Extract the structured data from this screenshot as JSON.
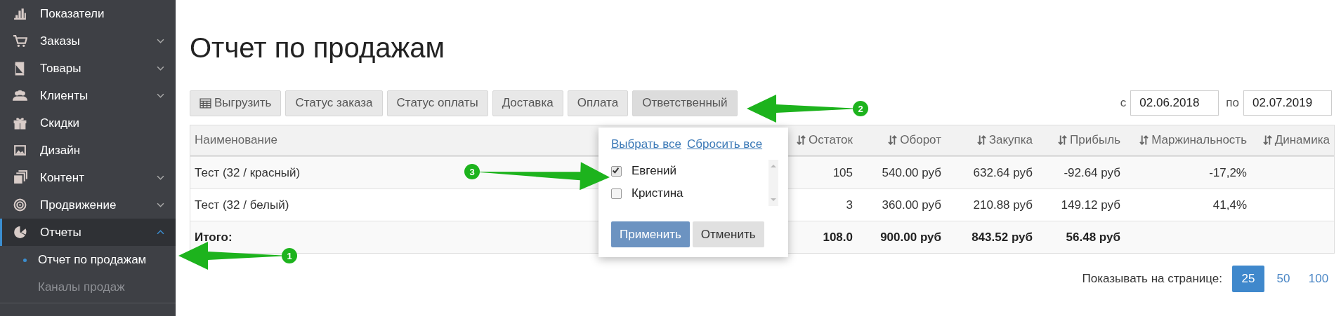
{
  "sidebar": {
    "items": [
      {
        "label": "Показатели",
        "expandable": false,
        "expanded": false,
        "selected": false
      },
      {
        "label": "Заказы",
        "expandable": true,
        "expanded": false,
        "selected": false
      },
      {
        "label": "Товары",
        "expandable": true,
        "expanded": false,
        "selected": false
      },
      {
        "label": "Клиенты",
        "expandable": true,
        "expanded": false,
        "selected": false
      },
      {
        "label": "Скидки",
        "expandable": false,
        "expanded": false,
        "selected": false
      },
      {
        "label": "Дизайн",
        "expandable": false,
        "expanded": false,
        "selected": false
      },
      {
        "label": "Контент",
        "expandable": true,
        "expanded": false,
        "selected": false
      },
      {
        "label": "Продвижение",
        "expandable": true,
        "expanded": false,
        "selected": false
      },
      {
        "label": "Отчеты",
        "expandable": true,
        "expanded": true,
        "selected": true,
        "children": [
          {
            "label": "Отчет по продажам",
            "selected": true
          },
          {
            "label": "Каналы продаж",
            "selected": false
          }
        ]
      }
    ]
  },
  "page": {
    "title": "Отчет по продажам"
  },
  "toolbar": {
    "buttons": [
      {
        "label": "Выгрузить",
        "kind": "export",
        "expanded": false
      },
      {
        "label": "Статус заказа",
        "kind": "filter",
        "expanded": false
      },
      {
        "label": "Статус оплаты",
        "kind": "filter",
        "expanded": false
      },
      {
        "label": "Доставка",
        "kind": "filter",
        "expanded": false
      },
      {
        "label": "Оплата",
        "kind": "filter",
        "expanded": false
      },
      {
        "label": "Ответственный",
        "kind": "filter",
        "expanded": true
      }
    ],
    "date_from_label": "с",
    "date_from": "02.06.2018",
    "date_to_label": "по",
    "date_to": "02.07.2019"
  },
  "table": {
    "columns": [
      {
        "label": "Наименование",
        "sortable": false
      },
      {
        "label": "Остаток",
        "sortable": true
      },
      {
        "label": "Оборот",
        "sortable": true
      },
      {
        "label": "Закупка",
        "sortable": true
      },
      {
        "label": "Прибыль",
        "sortable": true
      },
      {
        "label": "Маржинальность",
        "sortable": true
      },
      {
        "label": "Динамика",
        "sortable": true
      }
    ],
    "rows": [
      {
        "cells": [
          "Тест (32 / красный)",
          "105",
          "540.00 руб",
          "632.64 руб",
          "-92.64 руб",
          "-17,2%",
          ""
        ]
      },
      {
        "cells": [
          "Тест (32 / белый)",
          "3",
          "360.00 руб",
          "210.88 руб",
          "149.12 руб",
          "41,4%",
          ""
        ]
      }
    ],
    "total": {
      "cells": [
        "Итого:",
        "108.0",
        "900.00 руб",
        "843.52 руб",
        "56.48 руб",
        "",
        ""
      ]
    }
  },
  "filter_popup": {
    "select_all": "Выбрать все",
    "reset_all": "Сбросить все",
    "options": [
      {
        "label": "Евгений",
        "checked": true
      },
      {
        "label": "Кристина",
        "checked": false
      }
    ],
    "apply": "Применить",
    "cancel": "Отменить"
  },
  "pagination": {
    "label": "Показывать на странице:",
    "options": [
      {
        "label": "25",
        "selected": true
      },
      {
        "label": "50",
        "selected": false
      },
      {
        "label": "100",
        "selected": false
      }
    ]
  },
  "annotations": [
    {
      "number": "1"
    },
    {
      "number": "2"
    },
    {
      "number": "3"
    }
  ]
}
